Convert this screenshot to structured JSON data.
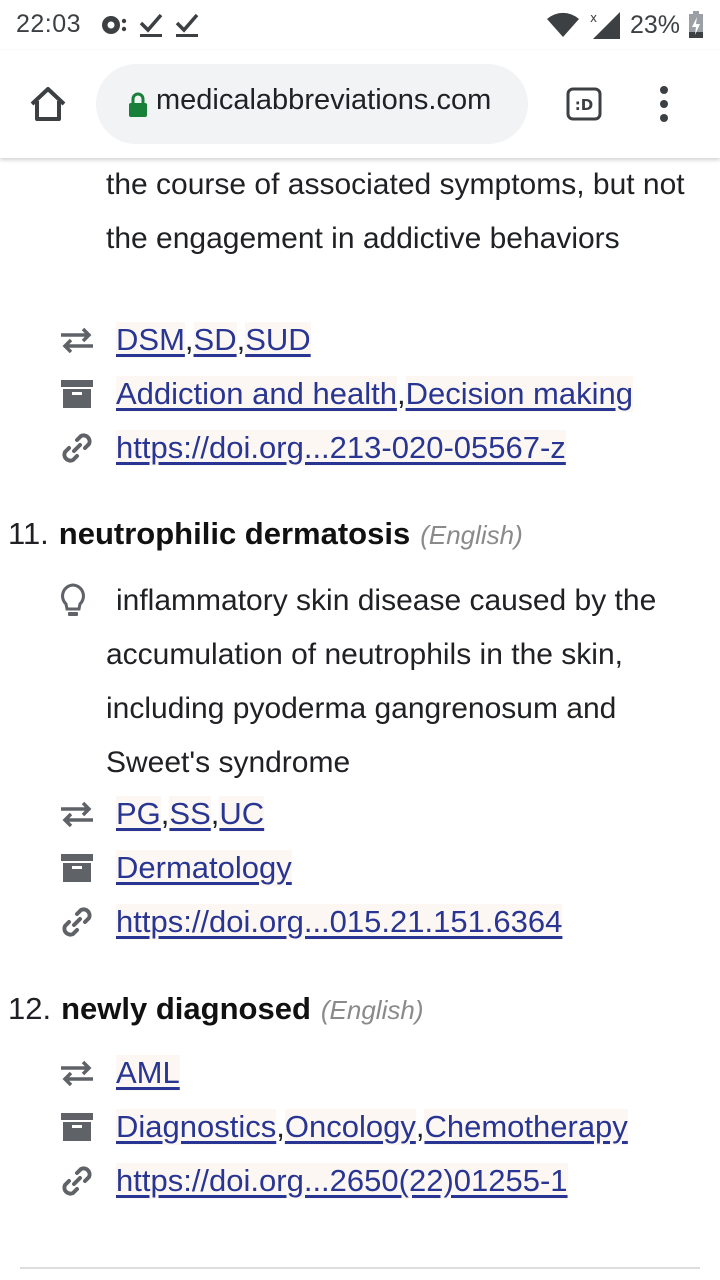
{
  "status_bar": {
    "time": "22:03",
    "battery_percent": "23%"
  },
  "browser": {
    "url": "medicalabbreviations.com",
    "tab_switcher_label": ":D"
  },
  "partial_entry": {
    "definition_tail": "the course of associated symptoms, but not the engagement in addictive behaviors",
    "abbreviations": [
      "DSM",
      "SD",
      "SUD"
    ],
    "categories": [
      "Addiction and health",
      "Decision making"
    ],
    "source": "https://doi.org...213-020-05567-z"
  },
  "entries": [
    {
      "number": "11.",
      "term": "neutrophilic dermatosis",
      "language": "(English)",
      "definition": "inflammatory skin disease caused by the accumulation of neutrophils in the skin, including pyoderma gangrenosum and Sweet's syndrome",
      "abbreviations": [
        "PG",
        "SS",
        "UC"
      ],
      "categories": [
        "Dermatology"
      ],
      "source": "https://doi.org...015.21.151.6364"
    },
    {
      "number": "12.",
      "term": "newly diagnosed",
      "language": "(English)",
      "abbreviations": [
        "AML"
      ],
      "categories": [
        "Diagnostics",
        "Oncology",
        "Chemotherapy"
      ],
      "source": "https://doi.org...2650(22)01255-1"
    }
  ],
  "icons": {
    "abbreviation": "swap-arrows-icon",
    "category": "archive-box-icon",
    "source": "link-icon",
    "definition": "lightbulb-icon"
  },
  "colors": {
    "link": "#283593",
    "secure_lock": "#188038"
  }
}
